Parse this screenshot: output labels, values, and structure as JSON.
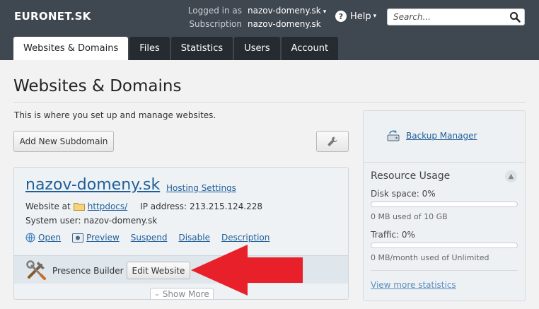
{
  "header": {
    "logo": "EURONET.SK",
    "logged_in_label": "Logged in as",
    "logged_in_value": "nazov-domeny.sk",
    "subscription_label": "Subscription",
    "subscription_value": "nazov-domeny.sk",
    "help_label": "Help",
    "search_placeholder": "Search..."
  },
  "tabs": [
    {
      "label": "Websites & Domains",
      "active": true
    },
    {
      "label": "Files",
      "active": false
    },
    {
      "label": "Statistics",
      "active": false
    },
    {
      "label": "Users",
      "active": false
    },
    {
      "label": "Account",
      "active": false
    }
  ],
  "main": {
    "title": "Websites & Domains",
    "intro": "This is where you set up and manage websites.",
    "add_subdomain_label": "Add New Subdomain"
  },
  "domain": {
    "name": "nazov-domeny.sk",
    "hosting_settings": "Hosting Settings",
    "website_at_label": "Website at",
    "docroot": "httpdocs/",
    "ip_label": "IP address:",
    "ip_value": "213.215.124.228",
    "system_user_label": "System user:",
    "system_user_value": "nazov-domeny.sk",
    "actions": [
      "Open",
      "Preview",
      "Suspend",
      "Disable",
      "Description"
    ],
    "presence_builder_label": "Presence Builder",
    "edit_website_label": "Edit Website",
    "show_more_label": "Show More"
  },
  "sidebar": {
    "backup_manager": "Backup Manager",
    "resource_usage_title": "Resource Usage",
    "disk_label": "Disk space: 0%",
    "disk_fraction": 0,
    "disk_note": "0 MB used of 10 GB",
    "traffic_label": "Traffic: 0%",
    "traffic_fraction": 0,
    "traffic_note": "0 MB/month used of Unlimited",
    "view_more_stats": "View more statistics"
  },
  "colors": {
    "header_bg": "#3f4750",
    "link": "#1f5e9a",
    "arrow": "#e8202a"
  }
}
